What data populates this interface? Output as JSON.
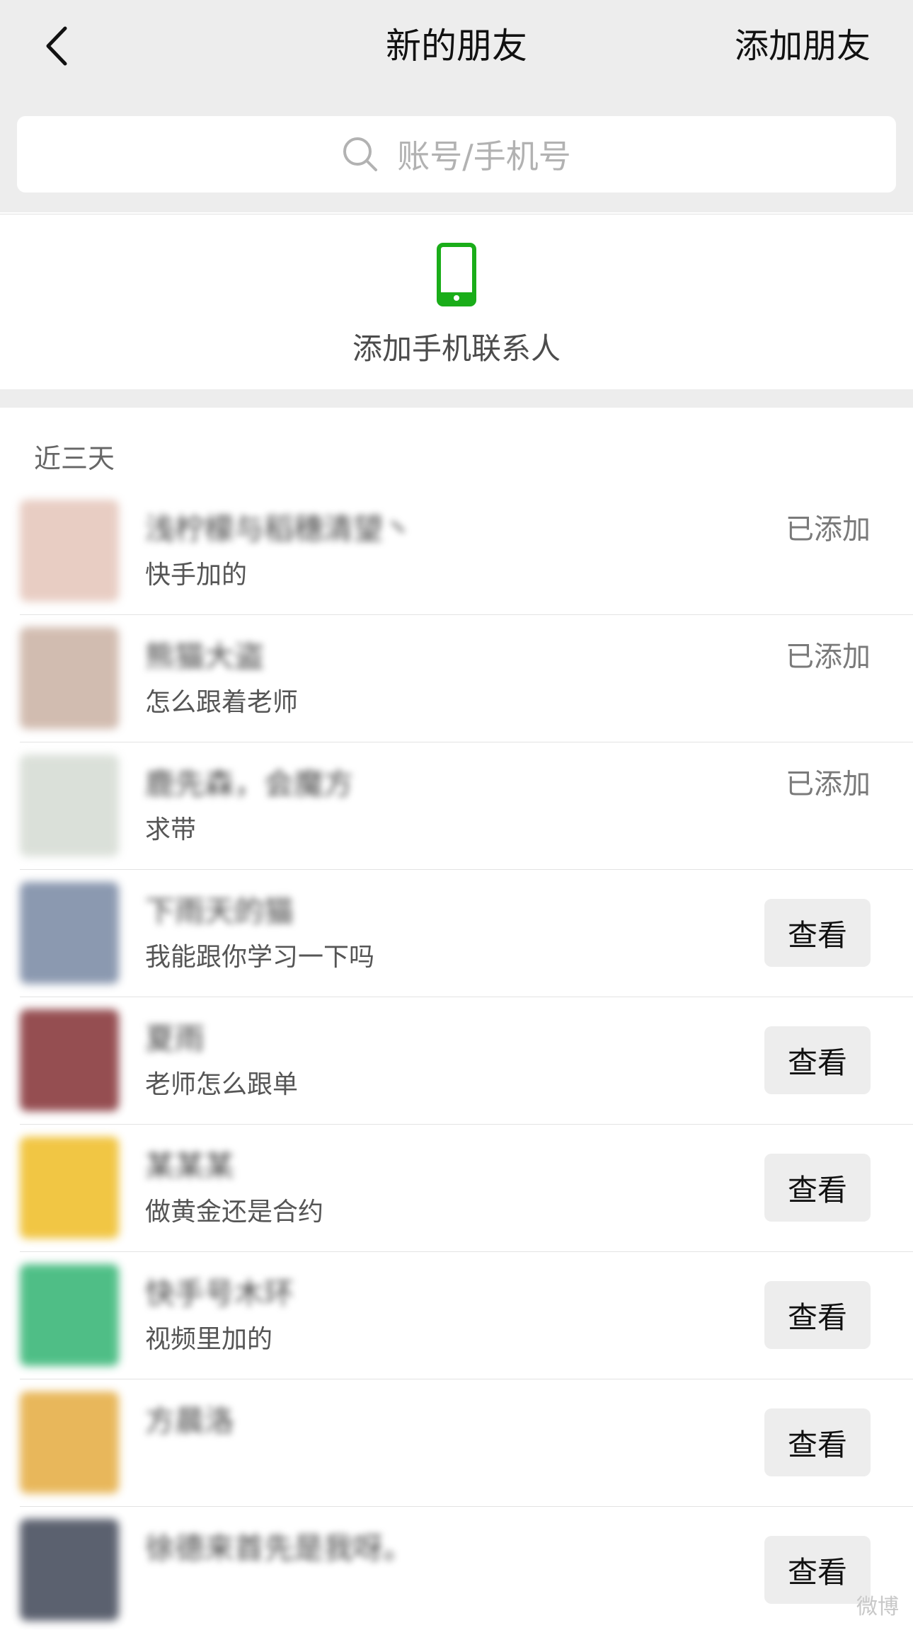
{
  "header": {
    "title": "新的朋友",
    "add_friend_label": "添加朋友"
  },
  "search": {
    "placeholder": "账号/手机号"
  },
  "phone_contacts": {
    "label": "添加手机联系人",
    "icon_color": "#1aad19"
  },
  "section": {
    "label": "近三天"
  },
  "requests": [
    {
      "name": "浅柠檬与稻穗清望丶",
      "note": "快手加的",
      "status": "已添加",
      "action": "",
      "avatar_color": "#e6c8bd"
    },
    {
      "name": "熊猫大盗",
      "note": "怎么跟着老师",
      "status": "已添加",
      "action": "",
      "avatar_color": "#cdb5a8"
    },
    {
      "name": "鹿先森，会魔方",
      "note": "求带",
      "status": "已添加",
      "action": "",
      "avatar_color": "#d7ddd5"
    },
    {
      "name": "下雨天的猫",
      "note": "我能跟你学习一下吗",
      "status": "",
      "action": "查看",
      "avatar_color": "#7f8ea8"
    },
    {
      "name": "夏雨",
      "note": "老师怎么跟单",
      "status": "",
      "action": "查看",
      "avatar_color": "#8a3b3f"
    },
    {
      "name": "某某某",
      "note": "做黄金还是合约",
      "status": "",
      "action": "查看",
      "avatar_color": "#f0c030"
    },
    {
      "name": "快手号木环",
      "note": "视频里加的",
      "status": "",
      "action": "查看",
      "avatar_color": "#3db87a"
    },
    {
      "name": "方晨洛",
      "note": "",
      "status": "",
      "action": "查看",
      "avatar_color": "#e6b04a"
    },
    {
      "name": "徐德来首先是我呀。",
      "note": "",
      "status": "",
      "action": "查看",
      "avatar_color": "#4a5060"
    }
  ],
  "watermark": "微博"
}
